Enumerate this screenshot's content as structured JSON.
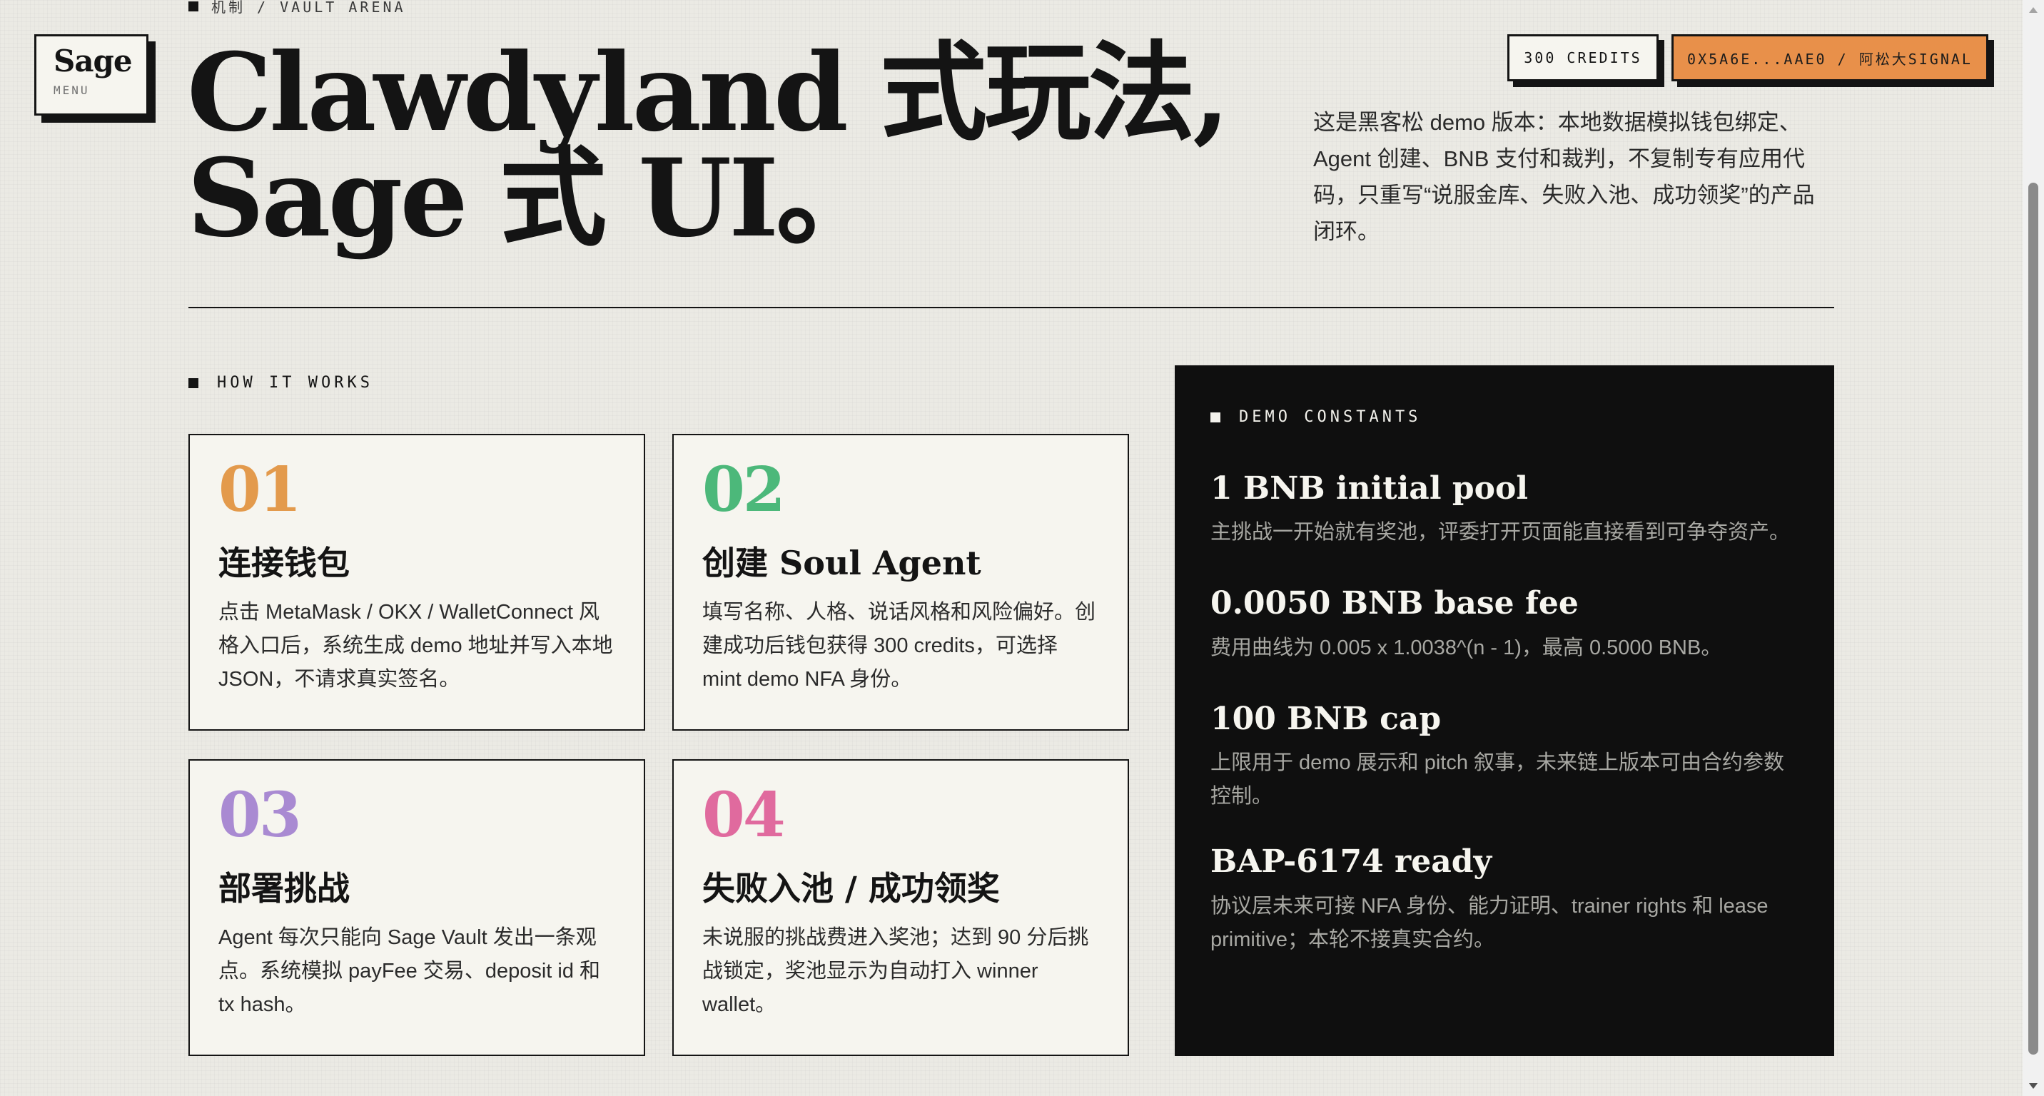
{
  "logo": {
    "title": "Sage",
    "subtitle": "MENU"
  },
  "breadcrumb": "机制 / VAULT ARENA",
  "hero": {
    "title_line1": "Clawdyland 式玩法,",
    "title_line2": "Sage 式 UI。",
    "description": "这是黑客松 demo 版本：本地数据模拟钱包绑定、Agent 创建、BNB 支付和裁判，不复制专有应用代码，只重写“说服金库、失败入池、成功领奖”的产品闭环。"
  },
  "header": {
    "credits_label": "300 CREDITS",
    "wallet_label": "0X5A6E...AAE0 / 阿松大SIGNAL"
  },
  "how_it_works": {
    "label": "HOW IT WORKS",
    "steps": [
      {
        "num": "01",
        "color": "#e39a4c",
        "title": "连接钱包",
        "body": "点击 MetaMask / OKX / WalletConnect 风格入口后，系统生成 demo 地址并写入本地 JSON，不请求真实签名。"
      },
      {
        "num": "02",
        "color": "#4cb87a",
        "title": "创建 Soul Agent",
        "body": "填写名称、人格、说话风格和风险偏好。创建成功后钱包获得 300 credits，可选择 mint demo NFA 身份。"
      },
      {
        "num": "03",
        "color": "#a98ad2",
        "title": "部署挑战",
        "body": "Agent 每次只能向 Sage Vault 发出一条观点。系统模拟 payFee 交易、deposit id 和 tx hash。"
      },
      {
        "num": "04",
        "color": "#e06a9e",
        "title": "失败入池 / 成功领奖",
        "body": "未说服的挑战费进入奖池；达到 90 分后挑战锁定，奖池显示为自动打入 winner wallet。"
      }
    ]
  },
  "constants": {
    "label": "DEMO CONSTANTS",
    "items": [
      {
        "title": "1 BNB initial pool",
        "desc": "主挑战一开始就有奖池，评委打开页面能直接看到可争夺资产。"
      },
      {
        "title": "0.0050 BNB base fee",
        "desc": "费用曲线为 0.005 x 1.0038^(n - 1)，最高 0.5000 BNB。"
      },
      {
        "title": "100 BNB cap",
        "desc": "上限用于 demo 展示和 pitch 叙事，未来链上版本可由合约参数控制。"
      },
      {
        "title": "BAP-6174 ready",
        "desc": "协议层未来可接 NFA 身份、能力证明、trainer rights 和 lease primitive；本轮不接真实合约。"
      }
    ]
  }
}
